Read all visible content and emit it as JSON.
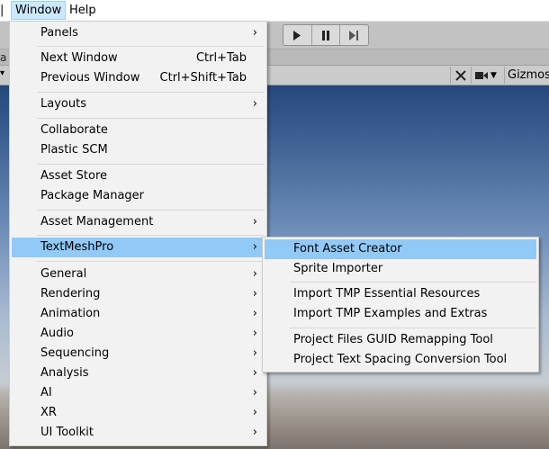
{
  "menubar": {
    "items": [
      "Window",
      "Help"
    ]
  },
  "toolbar": {
    "scene_tools": {
      "gizmos_label": "Gizmos"
    },
    "edge_tab": "a",
    "icons": [
      "play-icon",
      "pause-icon",
      "step-icon",
      "tools-icon",
      "camera-icon",
      "dropdown-icon"
    ]
  },
  "window_menu": {
    "items": [
      {
        "label": "Panels",
        "submenu": true
      },
      {
        "label": "Next Window",
        "shortcut": "Ctrl+Tab"
      },
      {
        "label": "Previous Window",
        "shortcut": "Ctrl+Shift+Tab"
      },
      {
        "label": "Layouts",
        "submenu": true
      },
      {
        "label": "Collaborate"
      },
      {
        "label": "Plastic SCM"
      },
      {
        "label": "Asset Store"
      },
      {
        "label": "Package Manager"
      },
      {
        "label": "Asset Management",
        "submenu": true
      },
      {
        "label": "TextMeshPro",
        "submenu": true,
        "highlighted": true
      },
      {
        "label": "General",
        "submenu": true
      },
      {
        "label": "Rendering",
        "submenu": true
      },
      {
        "label": "Animation",
        "submenu": true
      },
      {
        "label": "Audio",
        "submenu": true
      },
      {
        "label": "Sequencing",
        "submenu": true
      },
      {
        "label": "Analysis",
        "submenu": true
      },
      {
        "label": "AI",
        "submenu": true
      },
      {
        "label": "XR",
        "submenu": true
      },
      {
        "label": "UI Toolkit",
        "submenu": true
      }
    ],
    "arrow": "›"
  },
  "tmp_submenu": {
    "items": [
      {
        "label": "Font Asset Creator",
        "highlighted": true
      },
      {
        "label": "Sprite Importer"
      },
      {
        "label": "Import TMP Essential Resources"
      },
      {
        "label": "Import TMP Examples and Extras"
      },
      {
        "label": "Project Files GUID Remapping Tool"
      },
      {
        "label": "Project Text Spacing Conversion Tool"
      }
    ]
  },
  "colors": {
    "highlight": "#91c9f7",
    "menu_bg": "#f2f2f2",
    "menubar_active": "#cce8ff"
  }
}
